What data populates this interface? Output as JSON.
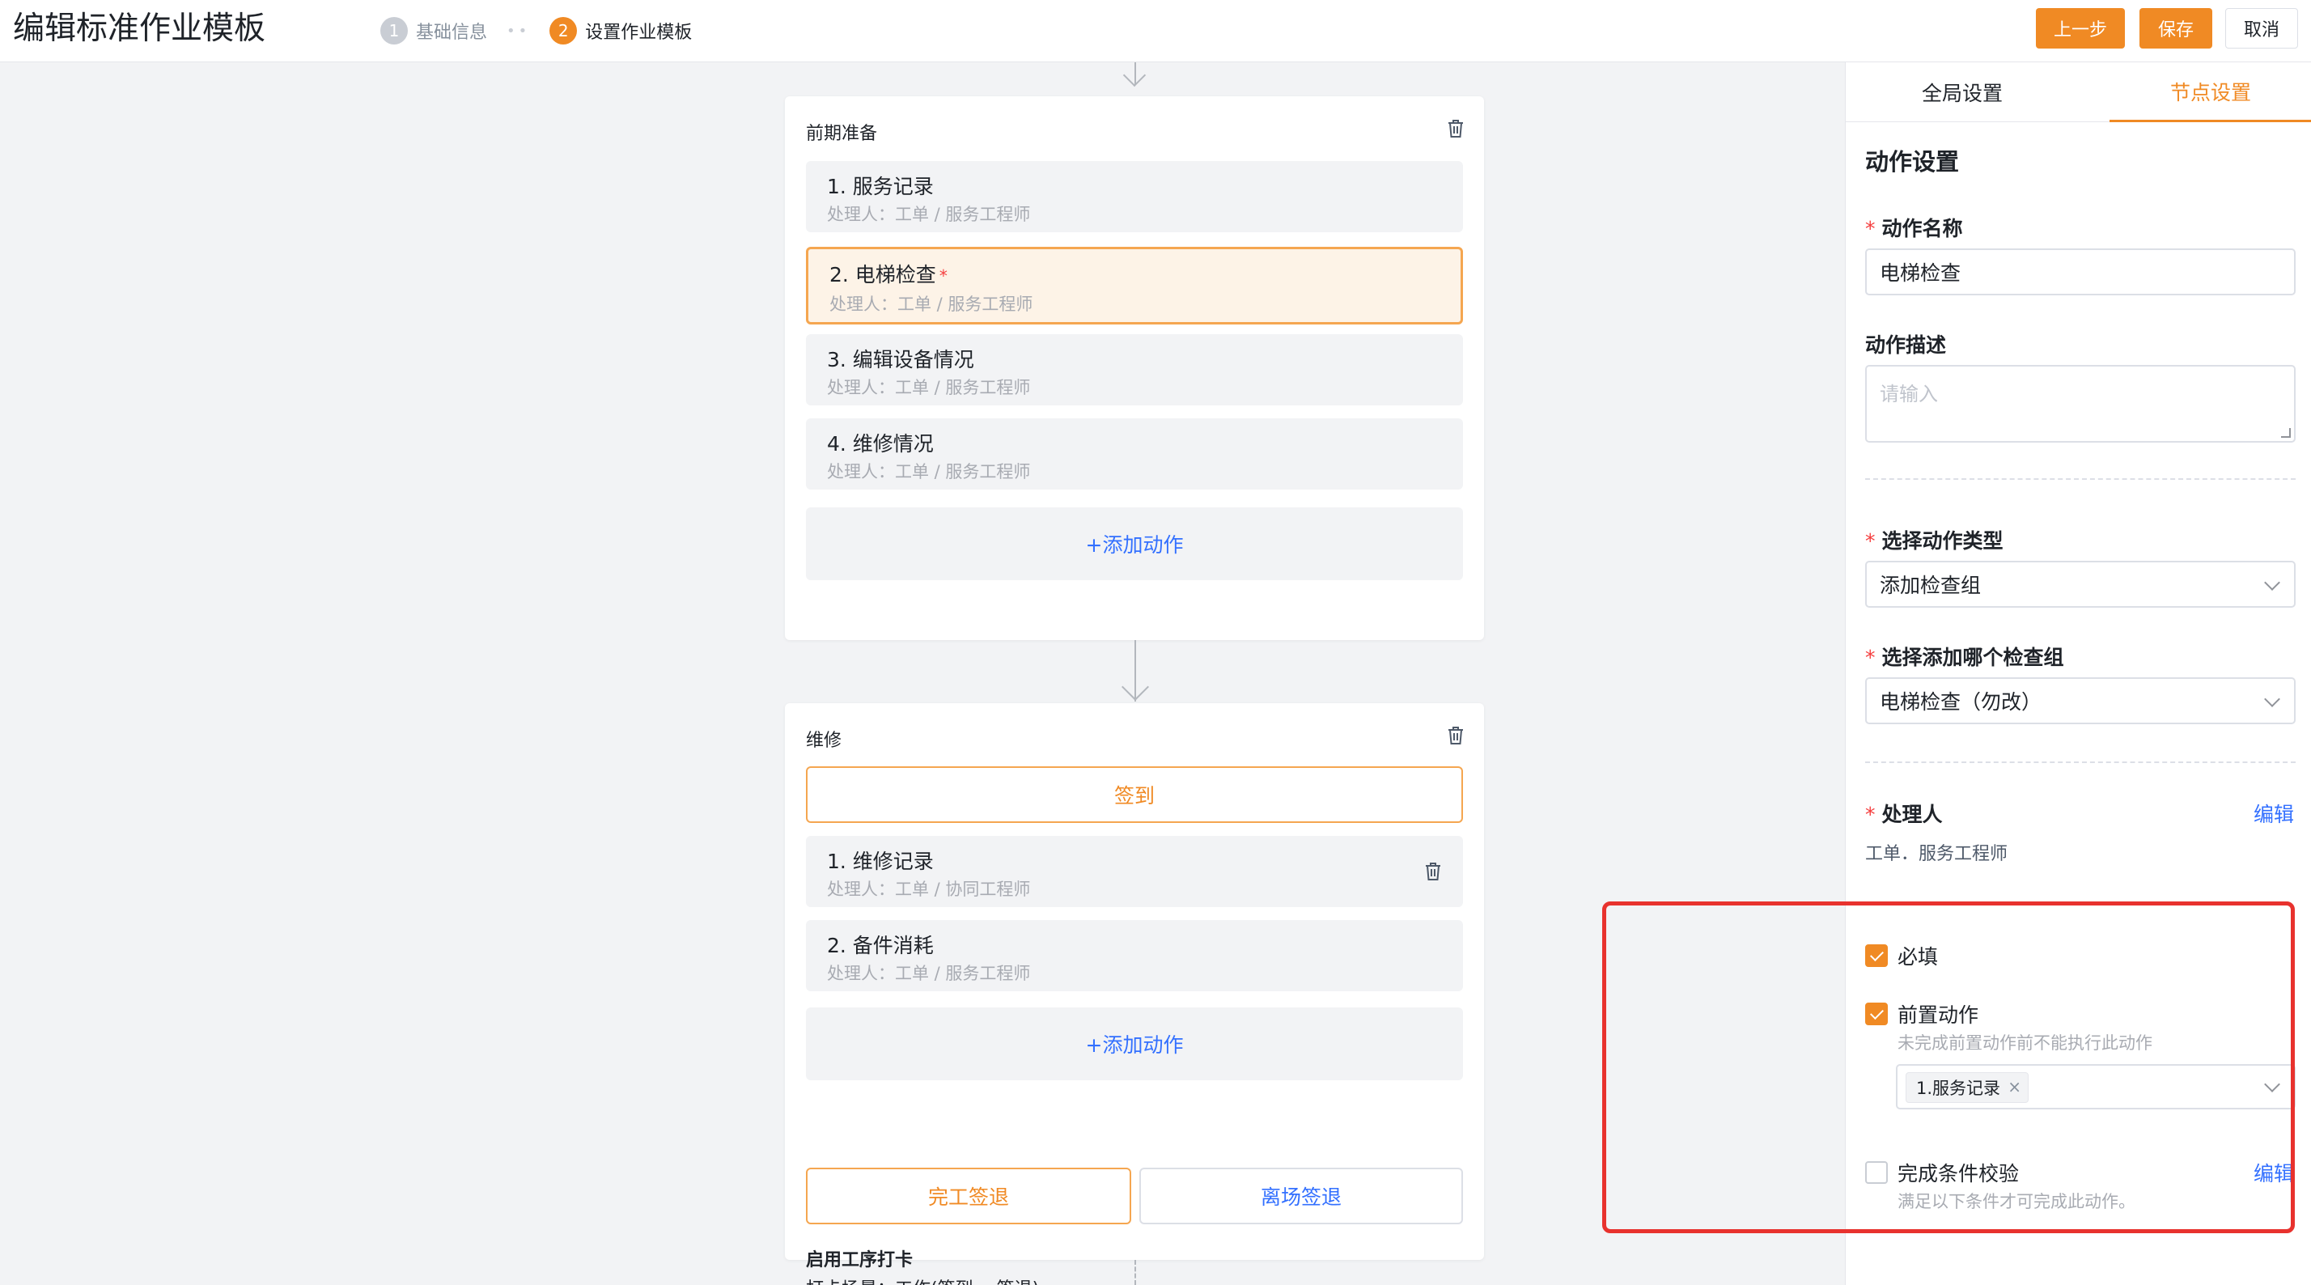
{
  "header": {
    "title": "编辑标准作业模板",
    "steps": [
      {
        "num": "1",
        "label": "基础信息"
      },
      {
        "num": "2",
        "label": "设置作业模板"
      }
    ],
    "step_separator": "••",
    "buttons": {
      "prev": "上一步",
      "save": "保存",
      "cancel": "取消"
    }
  },
  "canvas": {
    "node1": {
      "title": "前期准备",
      "actions": [
        {
          "name": "1. 服务记录",
          "handler": "处理人：工单 / 服务工程师"
        },
        {
          "name": "2. 电梯检查",
          "required_mark": "*",
          "handler": "处理人：工单 / 服务工程师"
        },
        {
          "name": "3. 编辑设备情况",
          "handler": "处理人：工单 / 服务工程师"
        },
        {
          "name": "4. 维修情况",
          "handler": "处理人：工单 / 服务工程师"
        }
      ],
      "add_action": "+添加动作"
    },
    "node2": {
      "title": "维修",
      "signin": "签到",
      "actions": [
        {
          "name": "1. 维修记录",
          "handler": "处理人：工单 / 协同工程师"
        },
        {
          "name": "2. 备件消耗",
          "handler": "处理人：工单 / 服务工程师"
        }
      ],
      "add_action": "+添加动作",
      "finish_signout": "完工签退",
      "leave_signout": "离场签退",
      "clock_title": "启用工序打卡",
      "clock_scene": "打卡场景：工作(签到 、签退)"
    }
  },
  "panel": {
    "tabs": {
      "global": "全局设置",
      "node": "节点设置"
    },
    "section_title": "动作设置",
    "action_name_label": "动作名称",
    "action_name_value": "电梯检查",
    "action_desc_label": "动作描述",
    "action_desc_placeholder": "请输入",
    "action_type_label": "选择动作类型",
    "action_type_value": "添加检查组",
    "check_group_label": "选择添加哪个检查组",
    "check_group_value": "电梯检查（勿改）",
    "handler_label": "处理人",
    "handler_edit": "编辑",
    "handler_value": "工单．服务工程师",
    "required": {
      "label": "必填",
      "checked": true
    },
    "pre_action": {
      "label": "前置动作",
      "checked": true,
      "hint": "未完成前置动作前不能执行此动作",
      "tag": "1.服务记录"
    },
    "completion_check": {
      "label": "完成条件校验",
      "checked": false,
      "edit": "编辑",
      "hint": "满足以下条件才可完成此动作。"
    }
  }
}
